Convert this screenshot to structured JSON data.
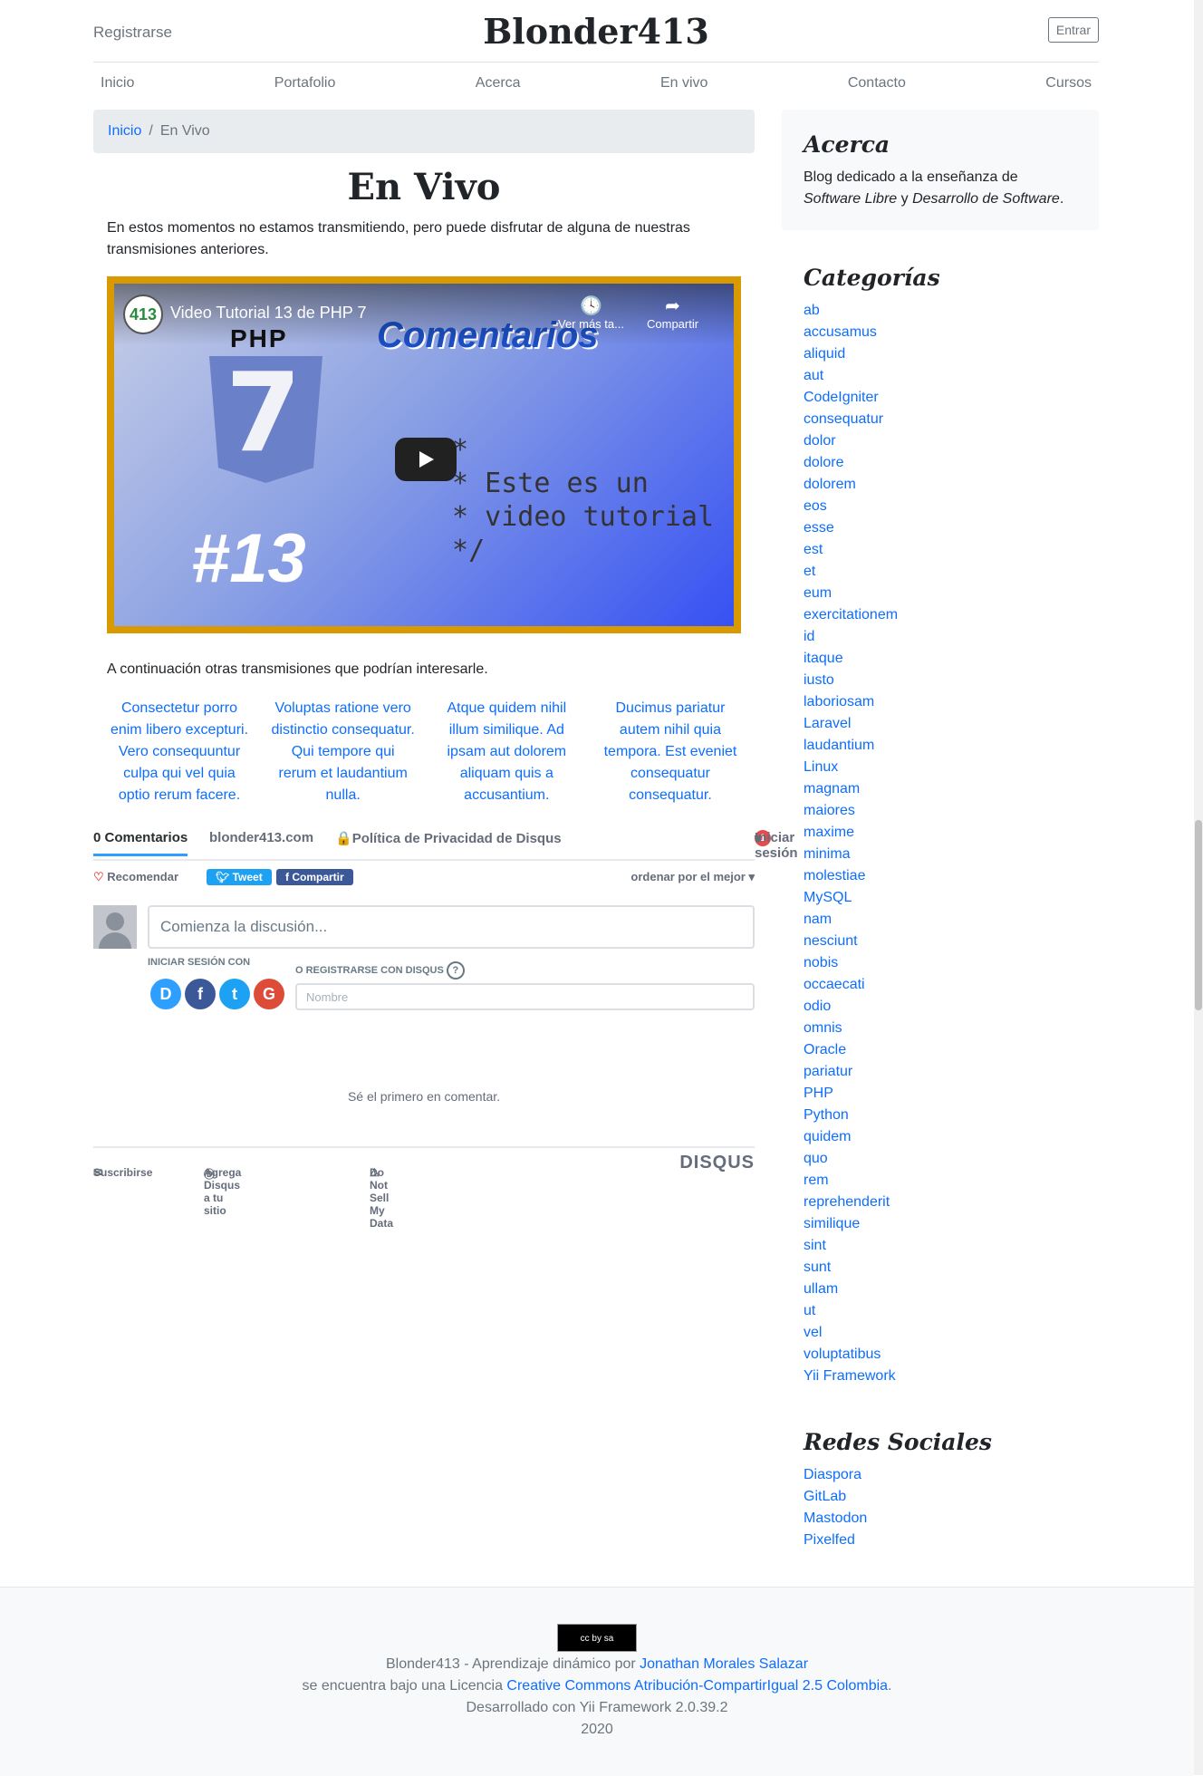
{
  "header": {
    "register": "Registrarse",
    "brand": "Blonder413",
    "login": "Entrar"
  },
  "nav": [
    "Inicio",
    "Portafolio",
    "Acerca",
    "En vivo",
    "Contacto",
    "Cursos"
  ],
  "breadcrumb": {
    "home": "Inicio",
    "sep": "/",
    "current": "En Vivo"
  },
  "main": {
    "title": "En Vivo",
    "intro": "En estos momentos no estamos transmitiendo, pero puede disfrutar de alguna de nuestras transmisiones anteriores.",
    "video": {
      "channel_logo": "413",
      "title": "Video Tutorial 13 de PHP 7",
      "watch_later": "Ver más ta...",
      "share": "Compartir",
      "thumb_php": "PHP",
      "thumb_seven": "7",
      "thumb_word": "Comentarios",
      "thumb_number": "#13",
      "thumb_code": "/*\n * Este es un\n * video tutorial\n */"
    },
    "more_text": "A continuación otras transmisiones que podrían interesarle.",
    "related": [
      "Consectetur porro enim libero excepturi. Vero consequuntur culpa qui vel quia optio rerum facere.",
      "Voluptas ratione vero distinctio consequatur. Qui tempore qui rerum et laudantium nulla.",
      "Atque quidem nihil illum similique. Ad ipsam aut dolorem aliquam quis a accusantium.",
      "Ducimus pariatur autem nihil quia tempora. Est eveniet consequatur consequatur."
    ]
  },
  "disqus": {
    "tab_comments": "0 Comentarios",
    "tab_site": "blonder413.com",
    "tab_privacy": "Política de Privacidad de Disqus",
    "notif_count": "1",
    "login": "Iniciar sesión",
    "recommend": "Recomendar",
    "tweet": "Tweet",
    "share": "Compartir",
    "sort": "ordenar por el mejor",
    "placeholder": "Comienza la discusión...",
    "login_with": "INICIAR SESIÓN CON",
    "or_register": "O REGISTRARSE CON DISQUS",
    "name_placeholder": "Nombre",
    "first": "Sé el primero en comentar.",
    "subscribe": "Suscribirse",
    "add_disqus": "Agrega Disqus a tu sitio",
    "dnsmd": "Do Not Sell My Data",
    "logo": "DISQUS"
  },
  "sidebar": {
    "about_title": "Acerca",
    "about_text_1": "Blog dedicado a la enseñanza de",
    "about_em_1": "Software Libre",
    "about_and": " y ",
    "about_em_2": "Desarrollo de Software",
    "about_end": ".",
    "categories_title": "Categorías",
    "categories": [
      "ab",
      "accusamus",
      "aliquid",
      "aut",
      "CodeIgniter",
      "consequatur",
      "dolor",
      "dolore",
      "dolorem",
      "eos",
      "esse",
      "est",
      "et",
      "eum",
      "exercitationem",
      "id",
      "itaque",
      "iusto",
      "laboriosam",
      "Laravel",
      "laudantium",
      "Linux",
      "magnam",
      "maiores",
      "maxime",
      "minima",
      "molestiae",
      "MySQL",
      "nam",
      "nesciunt",
      "nobis",
      "occaecati",
      "odio",
      "omnis",
      "Oracle",
      "pariatur",
      "PHP",
      "Python",
      "quidem",
      "quo",
      "rem",
      "reprehenderit",
      "similique",
      "sint",
      "sunt",
      "ullam",
      "ut",
      "vel",
      "voluptatibus",
      "Yii Framework"
    ],
    "social_title": "Redes Sociales",
    "social": [
      "Diaspora",
      "GitLab",
      "Mastodon",
      "Pixelfed"
    ]
  },
  "footer": {
    "cc_badge": "cc by sa",
    "line1_pre": "Blonder413 - Aprendizaje dinámico por ",
    "author": "Jonathan Morales Salazar",
    "line2_pre": "se encuentra bajo una Licencia ",
    "license": "Creative Commons Atribución-CompartirIgual 2.5 Colombia",
    "line2_post": ".",
    "line3": "Desarrollado con Yii Framework 2.0.39.2",
    "line4": "2020"
  },
  "colors": {
    "link": "#0d6efd",
    "video_frame": "#d89a00",
    "disqus_accent": "#2e9fff",
    "tweet": "#1da1f2",
    "facebook": "#3b5998"
  }
}
